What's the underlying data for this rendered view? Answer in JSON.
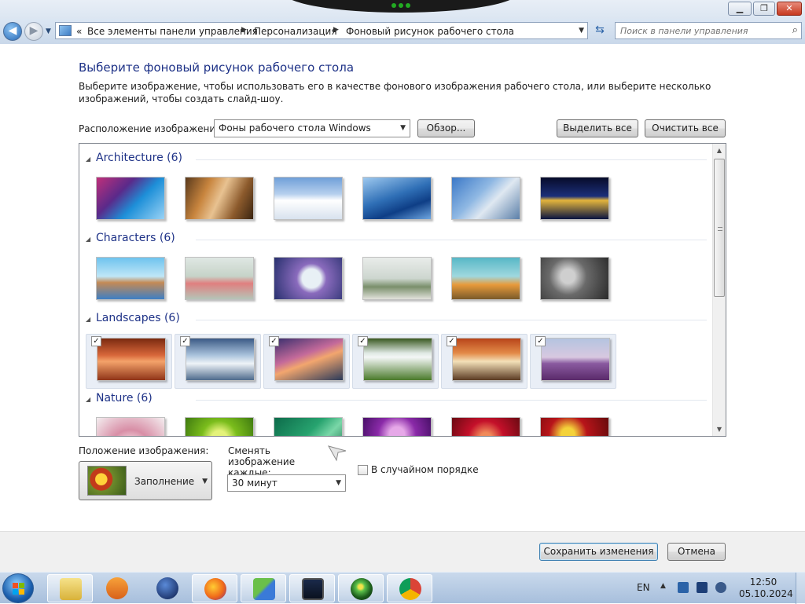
{
  "window": {
    "minimize_icon": "minimize-icon",
    "maximize_icon": "restore-icon",
    "close_icon": "close-icon"
  },
  "address": {
    "overflow": "«",
    "crumbs": [
      "Все элементы панели управления",
      "Персонализация",
      "Фоновый рисунок рабочего стола"
    ],
    "search_placeholder": "Поиск в панели управления"
  },
  "main": {
    "title": "Выберите фоновый рисунок рабочего стола",
    "description": "Выберите изображение, чтобы использовать его в качестве фонового изображения рабочего стола, или выберите несколько изображений, чтобы создать слайд-шоу.",
    "location_label": "Расположение изображения:",
    "location_value": "Фоны рабочего стола Windows",
    "browse_label": "Обзор...",
    "select_all_label": "Выделить все",
    "clear_all_label": "Очистить все"
  },
  "gallery": {
    "groups": [
      {
        "name": "Architecture (6)",
        "selected": false,
        "thumbs": [
          "linear-gradient(135deg,#c0307a 0%,#5a2a8a 35%,#1d8fd8 60%,#9ad3f5 100%)",
          "linear-gradient(115deg,#5a3a1c 0%,#c8853e 30%,#e8c291 50%,#8c5a2c 75%,#3a2410 100%)",
          "linear-gradient(180deg,#6f9fd8 0%,#b7d0ee 40%,#ffffff 55%,#d8e2ee 100%)",
          "linear-gradient(160deg,#9ec9ef 0%,#2f6fb6 45%,#0e3e86 70%,#6ea6e0 100%)",
          "linear-gradient(135deg,#3b78c7 0%,#8fb8e3 40%,#dfe8f1 60%,#5b7fa8 100%)",
          "linear-gradient(180deg,#070b2a 0%,#1c2f7a 45%,#e3b43c 55%,#0a1440 100%)"
        ]
      },
      {
        "name": "Characters (6)",
        "selected": false,
        "thumbs": [
          "linear-gradient(180deg,#6ec3ee 0%,#bfe6f7 45%,#c48a55 60%,#3e7fc4 100%)",
          "linear-gradient(180deg,#dfe7e3 0%,#c6d3c8 45%,#e07f7f 62%,#b5c5b8 100%)",
          "radial-gradient(circle at 55% 50%,#e8f0f5 0 22%,#8a6bbd 35%,#27306e 100%)",
          "linear-gradient(180deg,#e9ecea 0%,#cdd6cf 50%,#7a8f6b 70%,#e2e2dc 100%)",
          "linear-gradient(180deg,#58b7c6 0%,#9fd8de 45%,#e89a3b 65%,#7a5a2a 100%)",
          "radial-gradient(circle at 40% 45%,#cfcfcf 0 15%,#6a6a6a 40%,#2a2a2a 100%)"
        ]
      },
      {
        "name": "Landscapes (6)",
        "selected": true,
        "thumbs": [
          "linear-gradient(180deg,#7a2a10 0%,#d8673a 40%,#f4a36a 55%,#8f3418 100%)",
          "linear-gradient(180deg,#3b5a86 0%,#a9c2dc 40%,#eef3f8 60%,#4d6a8c 100%)",
          "linear-gradient(160deg,#3a2f6e 0%,#c46a9a 40%,#f2a66e 55%,#2a3a5a 100%)",
          "linear-gradient(180deg,#3a5a22 0%,#dfe9e4 35%,#f4f7f6 45%,#4a7a2a 100%)",
          "linear-gradient(180deg,#b8451a 0%,#e38a48 35%,#f3e0b8 55%,#5a3a22 100%)",
          "linear-gradient(180deg,#b4c4e0 0%,#d8c8e0 45%,#8a5aa0 60%,#5a2a6a 100%)"
        ]
      },
      {
        "name": "Nature (6)",
        "selected": false,
        "thumbs": [
          "radial-gradient(circle at 50% 80%,#f3d6de 0 20%,#d88ea6 45%,#f4eef0 100%)",
          "radial-gradient(circle at 50% 50%,#e4f27a 0 20%,#7bbd1c 45%,#3f7a10 100%)",
          "linear-gradient(135deg,#0d6b4a 0%,#27a36f 45%,#7ad7a8 65%,#0a5a3a 100%)",
          "radial-gradient(circle at 50% 40%,#e6a8e8 0 18%,#8a2aa8 45%,#3a0a5a 100%)",
          "radial-gradient(circle at 50% 50%,#f08a5a 0 15%,#c4102a 45%,#6a0a12 100%)",
          "radial-gradient(circle at 40% 40%,#f4d23a 0 14%,#b8141a 40%,#5a0a0a 100%)"
        ]
      }
    ]
  },
  "options": {
    "position_label": "Положение изображения:",
    "position_value": "Заполнение",
    "change_label": "Сменять изображение каждые:",
    "interval_value": "30 минут",
    "shuffle_label": "В случайном порядке",
    "shuffle_checked": false
  },
  "footer": {
    "save_label": "Сохранить изменения",
    "cancel_label": "Отмена"
  },
  "taskbar": {
    "apps": [
      "file-explorer-icon",
      "media-player-icon",
      "globe-icon",
      "firefox-icon",
      "people-icon",
      "monitor-icon",
      "windows-flag-icon",
      "chrome-icon"
    ],
    "language": "EN",
    "time": "12:50",
    "date": "05.10.2024"
  },
  "colors": {
    "title_blue": "#1e3287",
    "group_blue": "#1e3287",
    "taskbar": "#b7cce5"
  }
}
